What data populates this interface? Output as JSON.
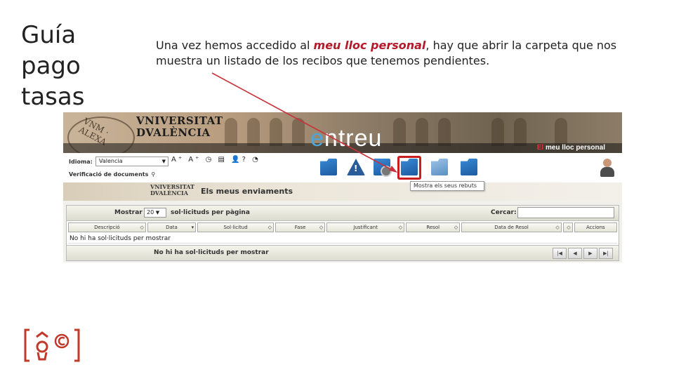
{
  "slide": {
    "title_lines": [
      "Guía",
      "pago",
      "tasas"
    ],
    "intro_before": "Una vez hemos accedido al ",
    "intro_highlight": "meu lloc personal",
    "intro_after": ", hay que abrir la carpeta que nos muestra un listado de los recibos que tenemos pendientes."
  },
  "banner": {
    "uv_line1": "VNIVERSITAT",
    "uv_line2": "DVALÈNCIA",
    "seal_text": "VNM · ALEXA",
    "app_name_e": "e",
    "app_name_rest": "ntreu",
    "meu_r": "El ",
    "meu_text": "meu lloc personal"
  },
  "toolbar": {
    "idioma_label": "Idioma:",
    "idioma_value": "Valencia",
    "tool_glyphs": "A⁺ A⁺ ◷ ▤ 👤? ◔",
    "verif_label": "Verificació de documents",
    "verif_icon": "⚲",
    "tooltip": "Mostra els seus rebuts"
  },
  "icons": [
    "folder-icon",
    "warning-icon",
    "film-folder-icon",
    "receipts-folder-icon",
    "forward-icon",
    "home-folder-icon",
    "user-icon"
  ],
  "subheader": {
    "uv_line1": "VNIVERSITAT",
    "uv_line2": "DVALÈNCIA",
    "title": "Els meus enviaments"
  },
  "grid": {
    "mostrar_label": "Mostrar",
    "page_size": "20",
    "per_page_label": "sol·licituds per pàgina",
    "search_label": "Cercar:",
    "columns": [
      {
        "label": "Descripció",
        "sort": "◇"
      },
      {
        "label": "Data",
        "sort": "▾"
      },
      {
        "label": "Sol·licitud",
        "sort": "◇"
      },
      {
        "label": "Fase",
        "sort": "◇"
      },
      {
        "label": "Justificant",
        "sort": "◇"
      },
      {
        "label": "Resol",
        "sort": "◇"
      },
      {
        "label": "Data de Resol",
        "sort": "◇"
      },
      {
        "label": "",
        "sort": "◇"
      },
      {
        "label": "Accions",
        "sort": ""
      }
    ],
    "empty_row": "No hi ha sol·licituds per mostrar",
    "bottom_message": "No hi ha sol·licituds per mostrar",
    "pager": [
      "|◀",
      "◀",
      "▶",
      "▶|"
    ]
  },
  "colors": {
    "highlight": "#b31a2a",
    "selection_border": "#c81e1e",
    "arrow": "#c8323a",
    "brand": "#c0392b"
  }
}
